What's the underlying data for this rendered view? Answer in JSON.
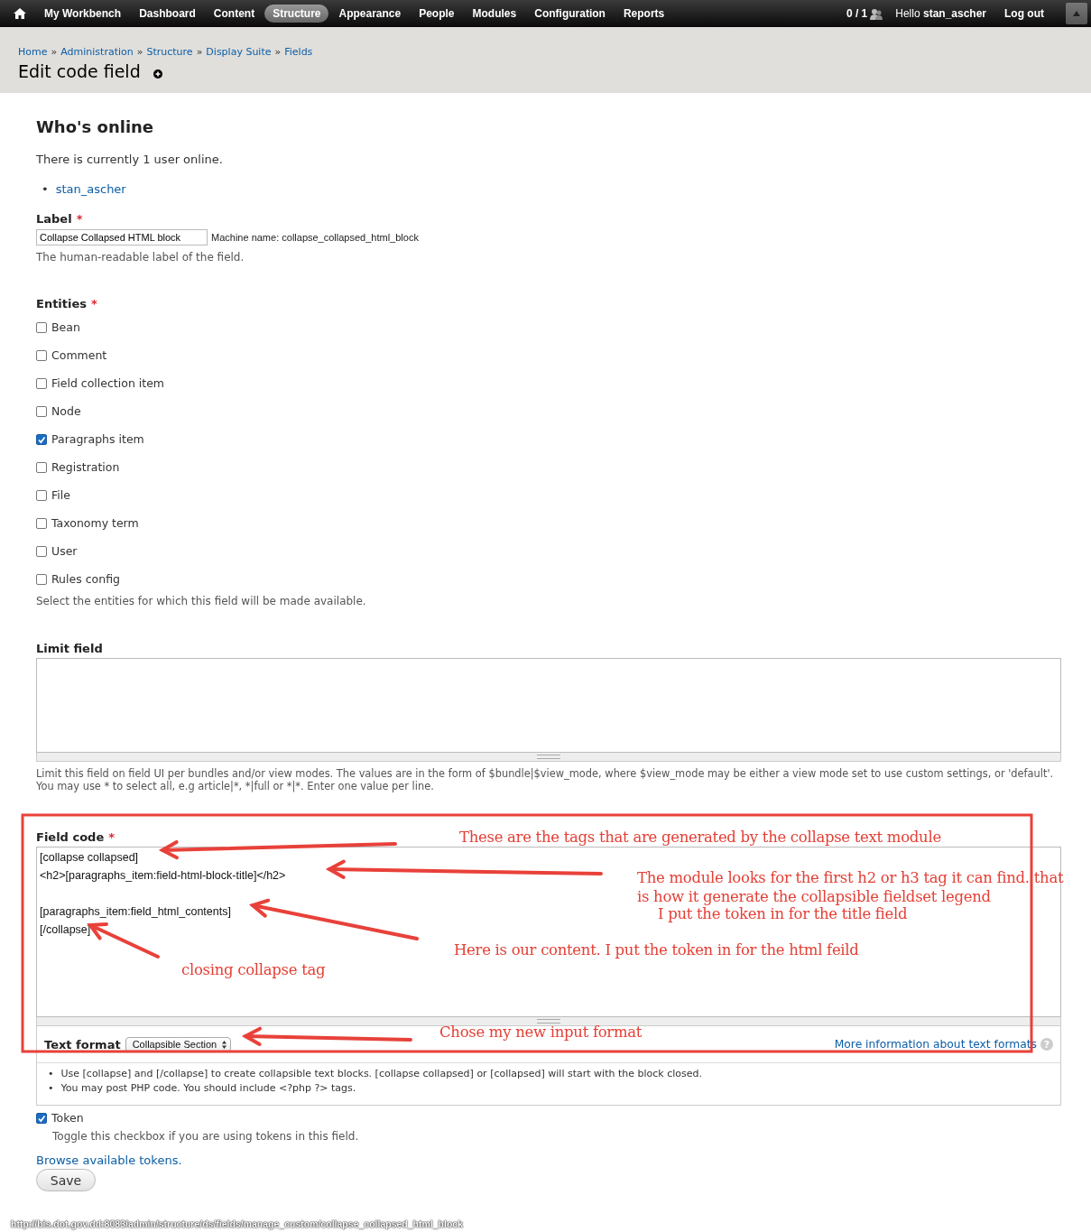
{
  "toolbar": {
    "menu": [
      {
        "label": "My Workbench",
        "selected": false
      },
      {
        "label": "Dashboard",
        "selected": false
      },
      {
        "label": "Content",
        "selected": false
      },
      {
        "label": "Structure",
        "selected": true
      },
      {
        "label": "Appearance",
        "selected": false
      },
      {
        "label": "People",
        "selected": false
      },
      {
        "label": "Modules",
        "selected": false
      },
      {
        "label": "Configuration",
        "selected": false
      },
      {
        "label": "Reports",
        "selected": false
      }
    ],
    "online_count": "0 / 1",
    "greeting": "Hello **stan_ascher**",
    "logout": "Log out"
  },
  "header": {
    "breadcrumb": [
      "Home",
      "Administration",
      "Structure",
      "Display Suite",
      "Fields"
    ],
    "separator": "»",
    "title": "Edit code field"
  },
  "whos_online": {
    "title": "Who's online",
    "text": "There is currently 1 user online.",
    "users": [
      "stan_ascher"
    ],
    "bullet": "•"
  },
  "label_field": {
    "label": "Label",
    "required": "*",
    "value": "Collapse Collapsed HTML block",
    "machine_name": "Machine name: collapse_collapsed_html_block",
    "help": "The human-readable label of the field."
  },
  "entities": {
    "label": "Entities",
    "required": "*",
    "options": [
      {
        "label": "Bean",
        "checked": false
      },
      {
        "label": "Comment",
        "checked": false
      },
      {
        "label": "Field collection item",
        "checked": false
      },
      {
        "label": "Node",
        "checked": false
      },
      {
        "label": "Paragraphs item",
        "checked": true
      },
      {
        "label": "Registration",
        "checked": false
      },
      {
        "label": "File",
        "checked": false
      },
      {
        "label": "Taxonomy term",
        "checked": false
      },
      {
        "label": "User",
        "checked": false
      },
      {
        "label": "Rules config",
        "checked": false
      }
    ],
    "help": "Select the entities for which this field will be made available."
  },
  "limit_field": {
    "label": "Limit field",
    "help": "Limit this field on field UI per bundles and/or view modes. The values are in the form of $bundle|$view_mode, where $view_mode may be either a view mode set to use custom settings, or 'default'. You may use * to select all, e.g article|*, *|full or *|*. Enter one value per line."
  },
  "field_code": {
    "label": "Field code",
    "required": "*",
    "value": "[collapse collapsed]\n<h2>[paragraphs_item:field-html-block-title]</h2>\n\n[paragraphs_item:field_html_contents]\n[/collapse]",
    "text_format": {
      "label": "Text format",
      "value": "Collapsible Section",
      "more_info": "More information about text formats",
      "help_icon": "?",
      "bullet": "•",
      "tips": [
        "Use [collapse] and [/collapse] to create collapsible text blocks. [collapse collapsed] or [collapsed] will start with the block closed.",
        "You may post PHP code. You should include <?php ?> tags."
      ]
    }
  },
  "token": {
    "label": "Token",
    "checked": true,
    "help": "Toggle this checkbox if you are using tokens in this field.",
    "browse_link": "Browse available tokens."
  },
  "save_button": "Save",
  "status_url": "http://bis.dot.gov.dd:8083/admin/structure/ds/fields/manage_custom/collapse_collapsed_html_block",
  "annotations": [
    {
      "lines": [
        "These are the tags that are generated by the collapse text module"
      ]
    },
    {
      "lines": [
        "The module looks for the first h2 or h3 tag it can find. that",
        "is how it generate the collapsible fieldset legend"
      ]
    },
    {
      "lines": [
        "I put the token in for the title field"
      ]
    },
    {
      "lines": [
        "Here is our content. I put the token in for the html feild"
      ]
    },
    {
      "lines": [
        "closing collapse tag"
      ]
    },
    {
      "lines": [
        "Chose my new input format"
      ]
    }
  ]
}
